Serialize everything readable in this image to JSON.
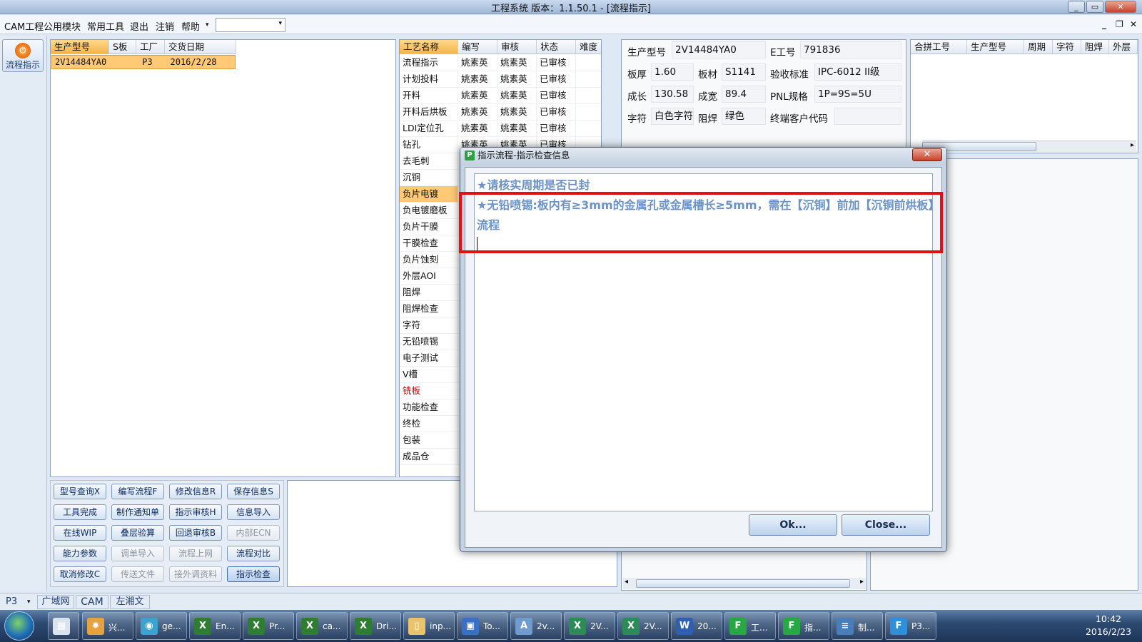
{
  "window": {
    "title": "工程系统  版本：1.1.50.1 - [流程指示]",
    "min": "_",
    "max": "▭",
    "close": "✕"
  },
  "menu": {
    "items": [
      "CAM工程",
      "公用模块",
      "常用工具",
      "退出",
      "注销",
      "帮助"
    ],
    "help_arrow": "▾",
    "combo_value": "",
    "combo_arrow": "▾",
    "mdi_min": "_",
    "mdi_restore": "❐",
    "mdi_close": "✕"
  },
  "leftbar": {
    "flow_button": "流程指示",
    "flow_icon": "⏻"
  },
  "orders": {
    "headers": [
      "生产型号",
      "S板",
      "工厂",
      "交货日期"
    ],
    "row": [
      "2V14484YA0",
      "",
      "P3",
      "2016/2/28"
    ]
  },
  "process": {
    "headers": [
      "工艺名称",
      "编写",
      "审核",
      "状态",
      "难度"
    ],
    "rows": [
      {
        "name": "流程指示",
        "writer": "姚素英",
        "auditor": "姚素英",
        "status": "已审核"
      },
      {
        "name": "计划投料",
        "writer": "姚素英",
        "auditor": "姚素英",
        "status": "已审核"
      },
      {
        "name": "开料",
        "writer": "姚素英",
        "auditor": "姚素英",
        "status": "已审核"
      },
      {
        "name": "开料后烘板",
        "writer": "姚素英",
        "auditor": "姚素英",
        "status": "已审核"
      },
      {
        "name": "LDI定位孔",
        "writer": "姚素英",
        "auditor": "姚素英",
        "status": "已审核"
      },
      {
        "name": "钻孔",
        "writer": "姚素英",
        "auditor": "姚素英",
        "status": "已审核"
      },
      {
        "name": "去毛刺",
        "writer": "",
        "auditor": "",
        "status": ""
      },
      {
        "name": "沉铜",
        "writer": "",
        "auditor": "",
        "status": ""
      },
      {
        "name": "负片电镀",
        "writer": "",
        "auditor": "",
        "status": ""
      },
      {
        "name": "负电镀磨板",
        "writer": "",
        "auditor": "",
        "status": ""
      },
      {
        "name": "负片干膜",
        "writer": "",
        "auditor": "",
        "status": ""
      },
      {
        "name": "干膜检查",
        "writer": "",
        "auditor": "",
        "status": ""
      },
      {
        "name": "负片蚀刻",
        "writer": "",
        "auditor": "",
        "status": ""
      },
      {
        "name": "外层AOI",
        "writer": "",
        "auditor": "",
        "status": ""
      },
      {
        "name": "阻焊",
        "writer": "",
        "auditor": "",
        "status": ""
      },
      {
        "name": "阻焊检查",
        "writer": "",
        "auditor": "",
        "status": ""
      },
      {
        "name": "字符",
        "writer": "",
        "auditor": "",
        "status": ""
      },
      {
        "name": "无铅喷锡",
        "writer": "",
        "auditor": "",
        "status": ""
      },
      {
        "name": "电子测试",
        "writer": "",
        "auditor": "",
        "status": ""
      },
      {
        "name": "V槽",
        "writer": "",
        "auditor": "",
        "status": ""
      },
      {
        "name": "铣板",
        "writer": "",
        "auditor": "",
        "status": ""
      },
      {
        "name": "功能检查",
        "writer": "",
        "auditor": "",
        "status": ""
      },
      {
        "name": "终检",
        "writer": "",
        "auditor": "",
        "status": ""
      },
      {
        "name": "包装",
        "writer": "",
        "auditor": "",
        "status": ""
      },
      {
        "name": "成品仓",
        "writer": "",
        "auditor": "",
        "status": ""
      }
    ]
  },
  "info": {
    "model_label": "生产型号",
    "model": "2V14484YA0",
    "eno_label": "E工号",
    "eno": "791836",
    "thick_label": "板厚",
    "thick": "1.60",
    "mat_label": "板材",
    "mat": "S1141",
    "std_label": "验收标准",
    "std": "IPC-6012 II级",
    "len_label": "成长",
    "len": "130.58",
    "wid_label": "成宽",
    "wid": "89.4",
    "pnl_label": "PNL规格",
    "pnl": "1P=9S=5U",
    "char_label": "字符",
    "char": "白色字符",
    "mask_label": "阻焊",
    "mask": "绿色",
    "cust_label": "终端客户代码",
    "cust": ""
  },
  "merge": {
    "headers": [
      "合拼工号",
      "生产型号",
      "周期",
      "字符",
      "阻焊",
      "外层"
    ],
    "scroll_right": "▸",
    "scroll_left": "◂"
  },
  "buttons": [
    [
      "型号查询X",
      "编写流程F",
      "修改信息R",
      "保存信息S"
    ],
    [
      "工具完成",
      "制作通知单",
      "指示审核H",
      "信息导入"
    ],
    [
      "在线WIP",
      "叠层验算",
      "回退审核B",
      "内部ECN"
    ],
    [
      "能力参数",
      "调单导入",
      "流程上网",
      "流程对比"
    ],
    [
      "取消修改C",
      "传送文件",
      "接外调资料",
      "指示检查"
    ]
  ],
  "status": {
    "factory": "P3",
    "arrow": "▾",
    "items": [
      "广域网",
      "CAM",
      "左湘文"
    ]
  },
  "dialog": {
    "title": "指示流程-指示检查信息",
    "close": "✕",
    "line1": "★请核实周期是否已封",
    "line2": "★无铅喷锡:板内有≥3mm的金属孔或金属槽长≥5mm，需在【沉铜】前加【沉铜前烘板】",
    "line3": "流程",
    "ok": "Ok...",
    "cancel": "Close..."
  },
  "taskbar": {
    "items": [
      "",
      "兴...",
      "ge...",
      "En...",
      "Pr...",
      "ca...",
      "Dri...",
      "inp...",
      "To...",
      "2v...",
      "2V...",
      "2V...",
      "20...",
      "工...",
      "指...",
      "制...",
      "P3..."
    ],
    "time": "10:42",
    "date": "2016/2/23"
  }
}
